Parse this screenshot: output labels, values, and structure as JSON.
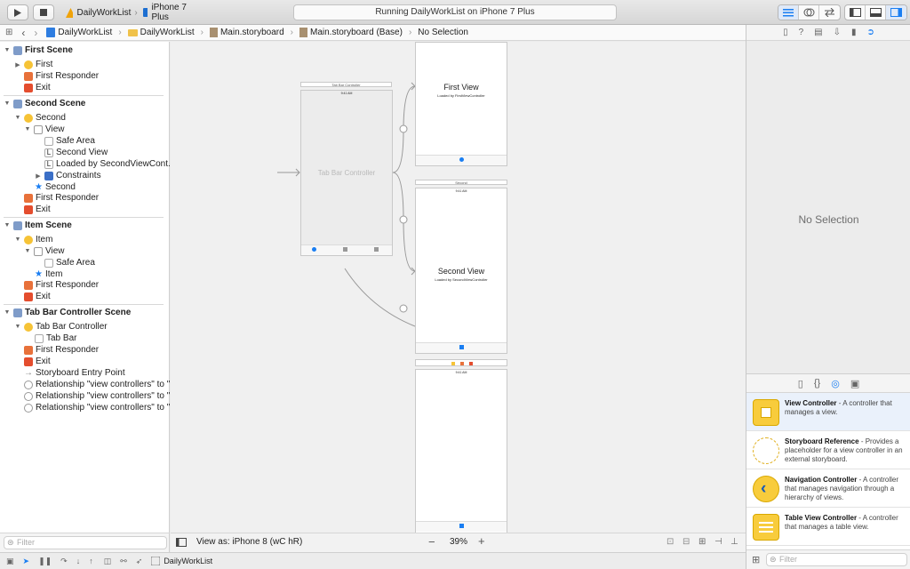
{
  "toolbar": {
    "scheme_project": "DailyWorkList",
    "scheme_device": "iPhone 7 Plus",
    "activity_status": "Running DailyWorkList on iPhone 7 Plus"
  },
  "jumpbar": {
    "items": [
      "DailyWorkList",
      "DailyWorkList",
      "Main.storyboard",
      "Main.storyboard (Base)",
      "No Selection"
    ]
  },
  "outline": {
    "first_scene": {
      "title": "First Scene",
      "first": "First",
      "first_responder": "First Responder",
      "exit": "Exit"
    },
    "second_scene": {
      "title": "Second Scene",
      "second": "Second",
      "view": "View",
      "safe_area": "Safe Area",
      "label_second_view": "Second View",
      "label_loaded_by": "Loaded by SecondViewCont...",
      "constraints": "Constraints",
      "tab_item": "Second",
      "first_responder": "First Responder",
      "exit": "Exit"
    },
    "item_scene": {
      "title": "Item Scene",
      "item": "Item",
      "view": "View",
      "safe_area": "Safe Area",
      "tab_item": "Item",
      "first_responder": "First Responder",
      "exit": "Exit"
    },
    "tab_bar_scene": {
      "title": "Tab Bar Controller Scene",
      "tab_bar_controller": "Tab Bar Controller",
      "tab_bar": "Tab Bar",
      "first_responder": "First Responder",
      "exit": "Exit",
      "entry_point": "Storyboard Entry Point",
      "relationship_1": "Relationship \"view controllers\" to \"...",
      "relationship_2": "Relationship \"view controllers\" to \"...",
      "relationship_3": "Relationship \"view controllers\" to \"..."
    },
    "filter_placeholder": "Filter"
  },
  "canvas": {
    "tab_bar_controller_title": "Tab Bar Controller",
    "tab_bar_controller_label": "Tab Bar Controller",
    "status_time": "9:41 AM",
    "first_view_title": "First View",
    "first_view_subtitle": "Loaded by FirstViewController",
    "second_scene_title": "Second",
    "second_view_title": "Second View",
    "second_view_subtitle": "Loaded by SecondViewController",
    "tab_first": "First",
    "tab_second": "Second",
    "tab_item": "Item"
  },
  "canvas_bar": {
    "view_as": "View as: iPhone 8 (wC hR)",
    "zoom_minus": "−",
    "zoom": "39%",
    "zoom_plus": "+"
  },
  "debug_bar": {
    "target": "DailyWorkList"
  },
  "inspector": {
    "no_selection": "No Selection"
  },
  "library": {
    "items": [
      {
        "title": "View Controller",
        "desc": " - A controller that manages a view."
      },
      {
        "title": "Storyboard Reference",
        "desc": " - Provides a placeholder for a view controller in an external storyboard."
      },
      {
        "title": "Navigation Controller",
        "desc": " - A controller that manages navigation through a hierarchy of views."
      },
      {
        "title": "Table View Controller",
        "desc": " - A controller that manages a table view."
      }
    ],
    "filter_placeholder": "Filter"
  },
  "colors": {
    "accent": "#1a7ef2",
    "scene_icon": "#f6c336",
    "responder": "#e8713a",
    "exit": "#e44d2e"
  }
}
